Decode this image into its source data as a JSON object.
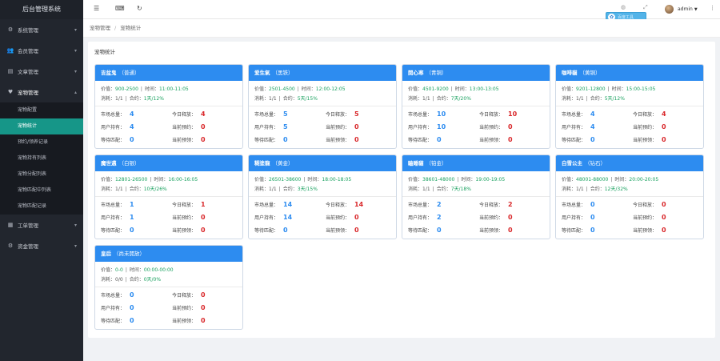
{
  "app": {
    "title": "后台管理系统"
  },
  "sidebar": {
    "items": [
      {
        "label": "系统管理",
        "icon": "gear-icon"
      },
      {
        "label": "会员管理",
        "icon": "users-icon"
      },
      {
        "label": "文章管理",
        "icon": "document-icon"
      },
      {
        "label": "宠物管理",
        "icon": "heart-icon",
        "open": true,
        "children": [
          "宠物配置",
          "宠物统计",
          "预约/领养记录",
          "宠物持有列表",
          "宠物分配列表",
          "宠物匹配中列表",
          "宠物匹配记录"
        ]
      },
      {
        "label": "工单管理",
        "icon": "ticket-icon"
      },
      {
        "label": "资金管理",
        "icon": "gear-icon"
      }
    ],
    "active_child": "宠物统计"
  },
  "header": {
    "icons": [
      "menu-icon",
      "keyboard-icon",
      "refresh-icon"
    ],
    "user": "admin",
    "badge_text": "百度工具"
  },
  "breadcrumb": [
    "宠物管理",
    "宠物统计"
  ],
  "panel": {
    "title": "宠物统计"
  },
  "labels": {
    "price": "价值：",
    "time": "时间：",
    "consume": "消耗：",
    "contract": "合约：",
    "market_total": "市场总量：",
    "today_release": "今日释放：",
    "user_hold": "用户持有：",
    "current_booking": "当前预约：",
    "waiting_match": "等待匹配：",
    "current_reserve": "当前预领："
  },
  "cards": [
    {
      "name": "吉盆鬼",
      "level": "（普通）",
      "price": "900-2500",
      "time": "11:00-11:05",
      "consume": "1/1",
      "contract": "1天/12%",
      "market_total": "4",
      "today_release": "4",
      "user_hold": "4",
      "current_booking": "0",
      "waiting_match": "0",
      "current_reserve": "0"
    },
    {
      "name": "爱生氣",
      "level": "（黑铁）",
      "price": "2501-4500",
      "time": "12:00-12:05",
      "consume": "1/1",
      "contract": "5天/15%",
      "market_total": "5",
      "today_release": "5",
      "user_hold": "5",
      "current_booking": "0",
      "waiting_match": "0",
      "current_reserve": "0"
    },
    {
      "name": "開心寒",
      "level": "（青铜）",
      "price": "4501-9200",
      "time": "13:00-13:05",
      "consume": "1/1",
      "contract": "7天/20%",
      "market_total": "10",
      "today_release": "10",
      "user_hold": "10",
      "current_booking": "0",
      "waiting_match": "0",
      "current_reserve": "0"
    },
    {
      "name": "咖啡貓",
      "level": "（黄铜）",
      "price": "9201-12800",
      "time": "15:00-15:05",
      "consume": "1/1",
      "contract": "5天/12%",
      "market_total": "4",
      "today_release": "4",
      "user_hold": "4",
      "current_booking": "0",
      "waiting_match": "0",
      "current_reserve": "0"
    },
    {
      "name": "魔世邁",
      "level": "（白银）",
      "price": "12801-26500",
      "time": "16:00-16:05",
      "consume": "1/1",
      "contract": "10天/26%",
      "market_total": "1",
      "today_release": "1",
      "user_hold": "1",
      "current_booking": "0",
      "waiting_match": "0",
      "current_reserve": "0"
    },
    {
      "name": "糊塗龍",
      "level": "（黄金）",
      "price": "26501-38600",
      "time": "18:00-18:05",
      "consume": "1/1",
      "contract": "3天/15%",
      "market_total": "14",
      "today_release": "14",
      "user_hold": "14",
      "current_booking": "0",
      "waiting_match": "0",
      "current_reserve": "0"
    },
    {
      "name": "瞌睡貓",
      "level": "（铂金）",
      "price": "38601-48000",
      "time": "19:00-19:05",
      "consume": "1/1",
      "contract": "7天/18%",
      "market_total": "2",
      "today_release": "2",
      "user_hold": "2",
      "current_booking": "0",
      "waiting_match": "0",
      "current_reserve": "0"
    },
    {
      "name": "白雪公主",
      "level": "（钻石）",
      "price": "48001-88000",
      "time": "20:00-20:05",
      "consume": "1/1",
      "contract": "12天/32%",
      "market_total": "0",
      "today_release": "0",
      "user_hold": "0",
      "current_booking": "0",
      "waiting_match": "0",
      "current_reserve": "0"
    },
    {
      "name": "皇后",
      "level": "（尚未開放）",
      "price": "0-0",
      "time": "00:00-00:00",
      "consume": "0/0",
      "contract": "0天/0%",
      "market_total": "0",
      "today_release": "0",
      "user_hold": "0",
      "current_booking": "0",
      "waiting_match": "0",
      "current_reserve": "0"
    }
  ],
  "colors": {
    "sidebar_bg": "#22262e",
    "active_menu": "#169688",
    "card_header": "#2d8cf0",
    "value_blue": "#2d8cf0",
    "value_red": "#d9282b",
    "green_text": "#19a15f"
  }
}
